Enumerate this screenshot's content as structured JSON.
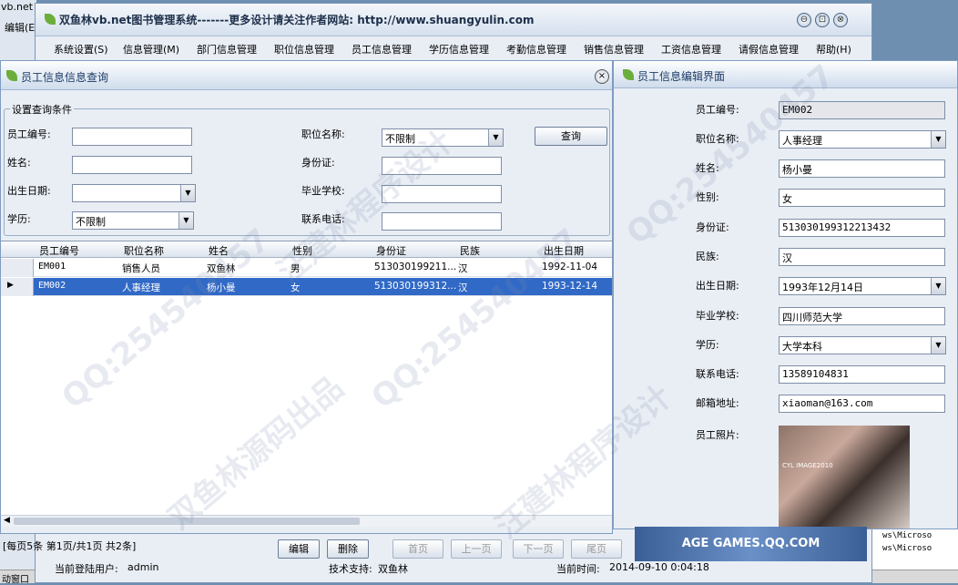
{
  "window": {
    "title": "双鱼林vb.net图书管理系统-------更多设计请关注作者网站:   http://www.shuangyulin.com",
    "controls": [
      "⊖",
      "⊡",
      "⊗"
    ]
  },
  "background": {
    "left_top": "vb.net",
    "left_edit": "编辑(E",
    "right_lines": [
      "ws\\Microso",
      "ws\\Microso"
    ],
    "taskbar": "动窗口",
    "banner": "AGE GAMES.QQ.COM"
  },
  "menu": [
    "系统设置(S)",
    "信息管理(M)",
    "部门信息管理",
    "职位信息管理",
    "员工信息管理",
    "学历信息管理",
    "考勤信息管理",
    "销售信息管理",
    "工资信息管理",
    "请假信息管理",
    "帮助(H)"
  ],
  "query": {
    "title": "员工信息信息查询",
    "group_title": "设置查询条件",
    "labels": {
      "emp_no": "员工编号:",
      "name": "姓名:",
      "birth": "出生日期:",
      "edu": "学历:",
      "position": "职位名称:",
      "id_card": "身份证:",
      "school": "毕业学校:",
      "phone": "联系电话:"
    },
    "values": {
      "emp_no": "",
      "name": "",
      "birth": "",
      "edu": "不限制",
      "position": "不限制",
      "id_card": "",
      "school": "",
      "phone": ""
    },
    "query_button": "查询"
  },
  "grid": {
    "columns": [
      "员工编号",
      "职位名称",
      "姓名",
      "性别",
      "身份证",
      "民族",
      "出生日期"
    ],
    "rows": [
      [
        "EM001",
        "销售人员",
        "双鱼林",
        "男",
        "513030199211...",
        "汉",
        "1992-11-04"
      ],
      [
        "EM002",
        "人事经理",
        "杨小曼",
        "女",
        "513030199312...",
        "汉",
        "1993-12-14"
      ]
    ],
    "selected_row": 1
  },
  "pager": {
    "info": "[每页5条  第1页/共1页    共2条]",
    "edit": "编辑",
    "delete": "删除",
    "first": "首页",
    "prev": "上一页",
    "next": "下一页",
    "last": "尾页"
  },
  "status": {
    "user_label": "当前登陆用户:",
    "user": "admin",
    "support_label": "技术支持:",
    "support": "双鱼林",
    "time_label": "当前时间:",
    "time": "2014-09-10 0:04:18"
  },
  "edit": {
    "title": "员工信息编辑界面",
    "fields": [
      {
        "label": "员工编号:",
        "value": "EM002",
        "type": "readonly"
      },
      {
        "label": "职位名称:",
        "value": "人事经理",
        "type": "combo"
      },
      {
        "label": "姓名:",
        "value": "杨小曼",
        "type": "text"
      },
      {
        "label": "性别:",
        "value": "女",
        "type": "text"
      },
      {
        "label": "身份证:",
        "value": "513030199312213432",
        "type": "text"
      },
      {
        "label": "民族:",
        "value": "汉",
        "type": "text"
      },
      {
        "label": "出生日期:",
        "value": "1993年12月14日",
        "type": "date"
      },
      {
        "label": "毕业学校:",
        "value": "四川师范大学",
        "type": "text"
      },
      {
        "label": "学历:",
        "value": "大学本科",
        "type": "combo"
      },
      {
        "label": "联系电话:",
        "value": "13589104831",
        "type": "text"
      },
      {
        "label": "邮箱地址:",
        "value": "xiaoman@163.com",
        "type": "text"
      }
    ],
    "photo_label": "员工照片:",
    "photo_caption": "CYL IMAGE2010"
  },
  "watermarks": [
    "QQ:254540457",
    "双鱼林源码出品",
    "汪建林程序设计"
  ]
}
